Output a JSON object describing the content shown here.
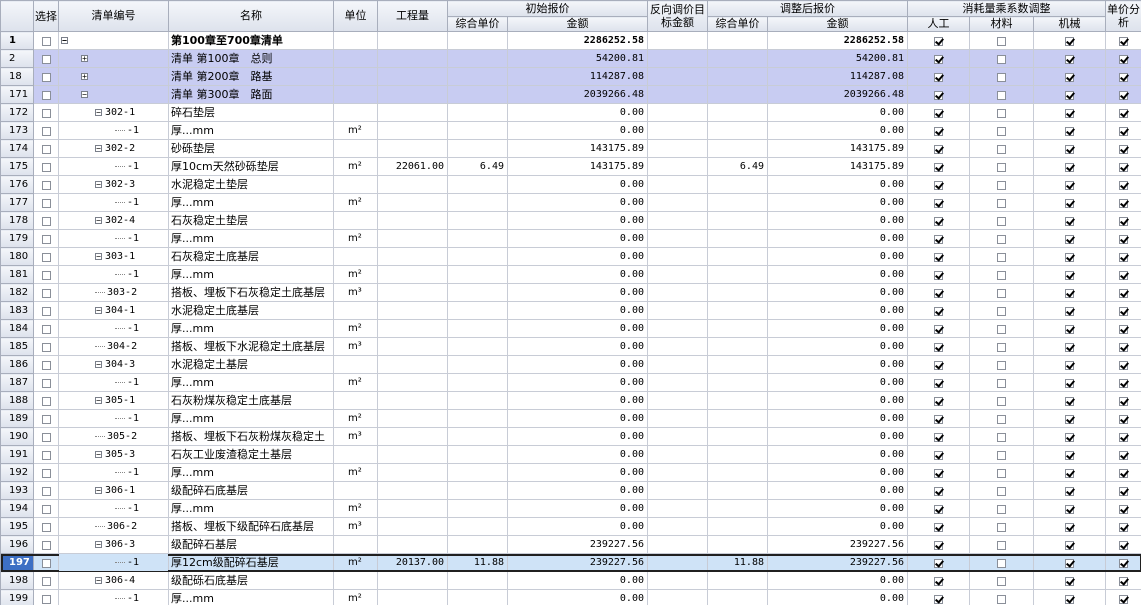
{
  "headers": {
    "select": "选择",
    "code": "清单编号",
    "name": "名称",
    "unit": "单位",
    "quantity": "工程量",
    "initial_group": "初始报价",
    "initial_unit_price": "综合单价",
    "initial_amount": "金额",
    "reverse_adjust": "反向调价目标金额",
    "adjusted_group": "调整后报价",
    "adjusted_unit_price": "综合单价",
    "adjusted_amount": "金额",
    "consumption_group": "消耗量乘系数调整",
    "labor": "人工",
    "material": "材料",
    "machine": "机械",
    "unit_price_analysis": "单价分析"
  },
  "rows": [
    {
      "num": "1",
      "code": "",
      "name": "第100章至700章清单",
      "unit": "",
      "qty": "",
      "iup": "",
      "iamt": "2286252.58",
      "rev": "",
      "aup": "",
      "aamt": "2286252.58",
      "lab": true,
      "mat": false,
      "mach": true,
      "ana": true,
      "level": 0,
      "toggle": "-",
      "style": "bold"
    },
    {
      "num": "2",
      "code": "",
      "name": "清单 第100章　总则",
      "unit": "",
      "qty": "",
      "iup": "",
      "iamt": "54200.81",
      "rev": "",
      "aup": "",
      "aamt": "54200.81",
      "lab": true,
      "mat": false,
      "mach": true,
      "ana": true,
      "level": 1,
      "toggle": "+",
      "style": "group"
    },
    {
      "num": "18",
      "code": "",
      "name": "清单 第200章　路基",
      "unit": "",
      "qty": "",
      "iup": "",
      "iamt": "114287.08",
      "rev": "",
      "aup": "",
      "aamt": "114287.08",
      "lab": true,
      "mat": false,
      "mach": true,
      "ana": true,
      "level": 1,
      "toggle": "+",
      "style": "group"
    },
    {
      "num": "171",
      "code": "",
      "name": "清单 第300章　路面",
      "unit": "",
      "qty": "",
      "iup": "",
      "iamt": "2039266.48",
      "rev": "",
      "aup": "",
      "aamt": "2039266.48",
      "lab": true,
      "mat": false,
      "mach": true,
      "ana": true,
      "level": 1,
      "toggle": "-",
      "style": "group"
    },
    {
      "num": "172",
      "code": "302-1",
      "name": "碎石垫层",
      "unit": "",
      "qty": "",
      "iup": "",
      "iamt": "0.00",
      "rev": "",
      "aup": "",
      "aamt": "0.00",
      "lab": true,
      "mat": false,
      "mach": true,
      "ana": true,
      "level": 2,
      "toggle": "-",
      "style": ""
    },
    {
      "num": "173",
      "code": "-1",
      "name": "厚...mm",
      "unit": "m²",
      "qty": "",
      "iup": "",
      "iamt": "0.00",
      "rev": "",
      "aup": "",
      "aamt": "0.00",
      "lab": true,
      "mat": false,
      "mach": true,
      "ana": true,
      "level": 3,
      "toggle": "",
      "style": ""
    },
    {
      "num": "174",
      "code": "302-2",
      "name": "砂砾垫层",
      "unit": "",
      "qty": "",
      "iup": "",
      "iamt": "143175.89",
      "rev": "",
      "aup": "",
      "aamt": "143175.89",
      "lab": true,
      "mat": false,
      "mach": true,
      "ana": true,
      "level": 2,
      "toggle": "-",
      "style": ""
    },
    {
      "num": "175",
      "code": "-1",
      "name": "厚10cm天然砂砾垫层",
      "unit": "m²",
      "qty": "22061.00",
      "iup": "6.49",
      "iamt": "143175.89",
      "rev": "",
      "aup": "6.49",
      "aamt": "143175.89",
      "lab": true,
      "mat": false,
      "mach": true,
      "ana": true,
      "level": 3,
      "toggle": "",
      "style": ""
    },
    {
      "num": "176",
      "code": "302-3",
      "name": "水泥稳定土垫层",
      "unit": "",
      "qty": "",
      "iup": "",
      "iamt": "0.00",
      "rev": "",
      "aup": "",
      "aamt": "0.00",
      "lab": true,
      "mat": false,
      "mach": true,
      "ana": true,
      "level": 2,
      "toggle": "-",
      "style": ""
    },
    {
      "num": "177",
      "code": "-1",
      "name": "厚...mm",
      "unit": "m²",
      "qty": "",
      "iup": "",
      "iamt": "0.00",
      "rev": "",
      "aup": "",
      "aamt": "0.00",
      "lab": true,
      "mat": false,
      "mach": true,
      "ana": true,
      "level": 3,
      "toggle": "",
      "style": ""
    },
    {
      "num": "178",
      "code": "302-4",
      "name": "石灰稳定土垫层",
      "unit": "",
      "qty": "",
      "iup": "",
      "iamt": "0.00",
      "rev": "",
      "aup": "",
      "aamt": "0.00",
      "lab": true,
      "mat": false,
      "mach": true,
      "ana": true,
      "level": 2,
      "toggle": "-",
      "style": ""
    },
    {
      "num": "179",
      "code": "-1",
      "name": "厚...mm",
      "unit": "m²",
      "qty": "",
      "iup": "",
      "iamt": "0.00",
      "rev": "",
      "aup": "",
      "aamt": "0.00",
      "lab": true,
      "mat": false,
      "mach": true,
      "ana": true,
      "level": 3,
      "toggle": "",
      "style": ""
    },
    {
      "num": "180",
      "code": "303-1",
      "name": "石灰稳定土底基层",
      "unit": "",
      "qty": "",
      "iup": "",
      "iamt": "0.00",
      "rev": "",
      "aup": "",
      "aamt": "0.00",
      "lab": true,
      "mat": false,
      "mach": true,
      "ana": true,
      "level": 2,
      "toggle": "-",
      "style": ""
    },
    {
      "num": "181",
      "code": "-1",
      "name": "厚...mm",
      "unit": "m²",
      "qty": "",
      "iup": "",
      "iamt": "0.00",
      "rev": "",
      "aup": "",
      "aamt": "0.00",
      "lab": true,
      "mat": false,
      "mach": true,
      "ana": true,
      "level": 3,
      "toggle": "",
      "style": ""
    },
    {
      "num": "182",
      "code": "303-2",
      "name": "搭板、埋板下石灰稳定土底基层",
      "unit": "m³",
      "qty": "",
      "iup": "",
      "iamt": "0.00",
      "rev": "",
      "aup": "",
      "aamt": "0.00",
      "lab": true,
      "mat": false,
      "mach": true,
      "ana": true,
      "level": 2,
      "toggle": "",
      "style": ""
    },
    {
      "num": "183",
      "code": "304-1",
      "name": "水泥稳定土底基层",
      "unit": "",
      "qty": "",
      "iup": "",
      "iamt": "0.00",
      "rev": "",
      "aup": "",
      "aamt": "0.00",
      "lab": true,
      "mat": false,
      "mach": true,
      "ana": true,
      "level": 2,
      "toggle": "-",
      "style": ""
    },
    {
      "num": "184",
      "code": "-1",
      "name": "厚...mm",
      "unit": "m²",
      "qty": "",
      "iup": "",
      "iamt": "0.00",
      "rev": "",
      "aup": "",
      "aamt": "0.00",
      "lab": true,
      "mat": false,
      "mach": true,
      "ana": true,
      "level": 3,
      "toggle": "",
      "style": ""
    },
    {
      "num": "185",
      "code": "304-2",
      "name": "搭板、埋板下水泥稳定土底基层",
      "unit": "m³",
      "qty": "",
      "iup": "",
      "iamt": "0.00",
      "rev": "",
      "aup": "",
      "aamt": "0.00",
      "lab": true,
      "mat": false,
      "mach": true,
      "ana": true,
      "level": 2,
      "toggle": "",
      "style": ""
    },
    {
      "num": "186",
      "code": "304-3",
      "name": "水泥稳定土基层",
      "unit": "",
      "qty": "",
      "iup": "",
      "iamt": "0.00",
      "rev": "",
      "aup": "",
      "aamt": "0.00",
      "lab": true,
      "mat": false,
      "mach": true,
      "ana": true,
      "level": 2,
      "toggle": "-",
      "style": ""
    },
    {
      "num": "187",
      "code": "-1",
      "name": "厚...mm",
      "unit": "m²",
      "qty": "",
      "iup": "",
      "iamt": "0.00",
      "rev": "",
      "aup": "",
      "aamt": "0.00",
      "lab": true,
      "mat": false,
      "mach": true,
      "ana": true,
      "level": 3,
      "toggle": "",
      "style": ""
    },
    {
      "num": "188",
      "code": "305-1",
      "name": "石灰粉煤灰稳定土底基层",
      "unit": "",
      "qty": "",
      "iup": "",
      "iamt": "0.00",
      "rev": "",
      "aup": "",
      "aamt": "0.00",
      "lab": true,
      "mat": false,
      "mach": true,
      "ana": true,
      "level": 2,
      "toggle": "-",
      "style": ""
    },
    {
      "num": "189",
      "code": "-1",
      "name": "厚...mm",
      "unit": "m²",
      "qty": "",
      "iup": "",
      "iamt": "0.00",
      "rev": "",
      "aup": "",
      "aamt": "0.00",
      "lab": true,
      "mat": false,
      "mach": true,
      "ana": true,
      "level": 3,
      "toggle": "",
      "style": ""
    },
    {
      "num": "190",
      "code": "305-2",
      "name": "搭板、埋板下石灰粉煤灰稳定土",
      "unit": "m³",
      "qty": "",
      "iup": "",
      "iamt": "0.00",
      "rev": "",
      "aup": "",
      "aamt": "0.00",
      "lab": true,
      "mat": false,
      "mach": true,
      "ana": true,
      "level": 2,
      "toggle": "",
      "style": ""
    },
    {
      "num": "191",
      "code": "305-3",
      "name": "石灰工业废渣稳定土基层",
      "unit": "",
      "qty": "",
      "iup": "",
      "iamt": "0.00",
      "rev": "",
      "aup": "",
      "aamt": "0.00",
      "lab": true,
      "mat": false,
      "mach": true,
      "ana": true,
      "level": 2,
      "toggle": "-",
      "style": ""
    },
    {
      "num": "192",
      "code": "-1",
      "name": "厚...mm",
      "unit": "m²",
      "qty": "",
      "iup": "",
      "iamt": "0.00",
      "rev": "",
      "aup": "",
      "aamt": "0.00",
      "lab": true,
      "mat": false,
      "mach": true,
      "ana": true,
      "level": 3,
      "toggle": "",
      "style": ""
    },
    {
      "num": "193",
      "code": "306-1",
      "name": "级配碎石底基层",
      "unit": "",
      "qty": "",
      "iup": "",
      "iamt": "0.00",
      "rev": "",
      "aup": "",
      "aamt": "0.00",
      "lab": true,
      "mat": false,
      "mach": true,
      "ana": true,
      "level": 2,
      "toggle": "-",
      "style": ""
    },
    {
      "num": "194",
      "code": "-1",
      "name": "厚...mm",
      "unit": "m²",
      "qty": "",
      "iup": "",
      "iamt": "0.00",
      "rev": "",
      "aup": "",
      "aamt": "0.00",
      "lab": true,
      "mat": false,
      "mach": true,
      "ana": true,
      "level": 3,
      "toggle": "",
      "style": ""
    },
    {
      "num": "195",
      "code": "306-2",
      "name": "搭板、埋板下级配碎石底基层",
      "unit": "m³",
      "qty": "",
      "iup": "",
      "iamt": "0.00",
      "rev": "",
      "aup": "",
      "aamt": "0.00",
      "lab": true,
      "mat": false,
      "mach": true,
      "ana": true,
      "level": 2,
      "toggle": "",
      "style": ""
    },
    {
      "num": "196",
      "code": "306-3",
      "name": "级配碎石基层",
      "unit": "",
      "qty": "",
      "iup": "",
      "iamt": "239227.56",
      "rev": "",
      "aup": "",
      "aamt": "239227.56",
      "lab": true,
      "mat": false,
      "mach": true,
      "ana": true,
      "level": 2,
      "toggle": "-",
      "style": ""
    },
    {
      "num": "197",
      "code": "-1",
      "name": "厚12cm级配碎石基层",
      "unit": "m²",
      "qty": "20137.00",
      "iup": "11.88",
      "iamt": "239227.56",
      "rev": "",
      "aup": "11.88",
      "aamt": "239227.56",
      "lab": true,
      "mat": false,
      "mach": true,
      "ana": true,
      "level": 3,
      "toggle": "",
      "style": "sel"
    },
    {
      "num": "198",
      "code": "306-4",
      "name": "级配砾石底基层",
      "unit": "",
      "qty": "",
      "iup": "",
      "iamt": "0.00",
      "rev": "",
      "aup": "",
      "aamt": "0.00",
      "lab": true,
      "mat": false,
      "mach": true,
      "ana": true,
      "level": 2,
      "toggle": "-",
      "style": ""
    },
    {
      "num": "199",
      "code": "-1",
      "name": "厚...mm",
      "unit": "m²",
      "qty": "",
      "iup": "",
      "iamt": "0.00",
      "rev": "",
      "aup": "",
      "aamt": "0.00",
      "lab": true,
      "mat": false,
      "mach": true,
      "ana": true,
      "level": 3,
      "toggle": "",
      "style": ""
    }
  ],
  "icons": {
    "check": "checkbox-icon",
    "expand": "expand-toggle-icon",
    "collapse": "collapse-toggle-icon"
  }
}
